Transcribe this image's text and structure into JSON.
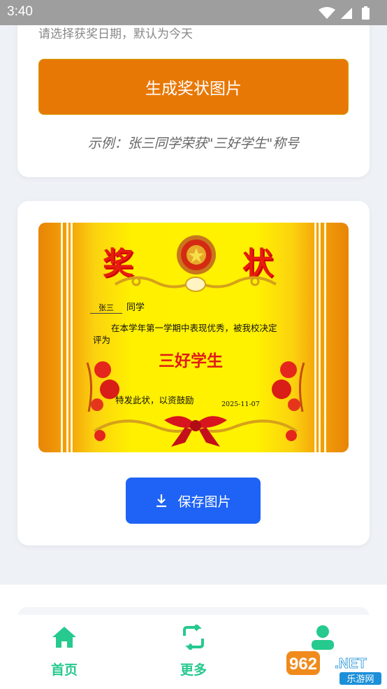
{
  "status_bar": {
    "time": "3:40"
  },
  "form": {
    "date_hint": "请选择获奖日期，默认为今天",
    "generate_label": "生成奖状图片",
    "example": "示例：张三同学荣获\"三好学生\"称号"
  },
  "certificate": {
    "title_left": "奖",
    "title_right": "状",
    "student_name": "张三",
    "student_suffix": "同学",
    "body_line1": "在本学年第一学期中表现优秀，被我校决定",
    "body_line2": "评为",
    "award": "三好学生",
    "closing": "特发此状，以资鼓励",
    "date": "2025-11-07"
  },
  "save_button": {
    "label": "保存图片",
    "icon": "download-icon"
  },
  "nav": {
    "items": [
      {
        "label": "首页",
        "icon": "home-icon"
      },
      {
        "label": "更多",
        "icon": "refresh-icon"
      },
      {
        "label": "",
        "icon": "profile-icon"
      }
    ]
  },
  "watermark": {
    "brand": "962.NET",
    "sub": "乐游网"
  },
  "colors": {
    "generate_button": "#e87806",
    "save_button": "#1e63f5",
    "nav_accent": "#26c98e",
    "certificate_title": "#e51d0e"
  }
}
